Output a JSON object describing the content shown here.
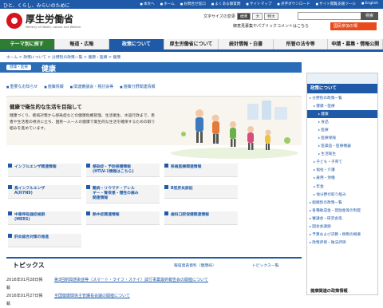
{
  "header": {
    "tagline": "ひと、くらし、みらいのために",
    "toplinks": [
      "本文へ",
      "ホーム",
      "お問合せ窓口",
      "よくある御質問",
      "サイトマップ",
      "点字ダウンロード",
      "サイト閲覧支援ツール",
      "English"
    ],
    "logo_text": "厚生労働省",
    "logo_en": "Ministry of Health, Labour and Welfare",
    "size_label": "文字サイズの変更",
    "size_opts": [
      "標準",
      "大",
      "特大"
    ],
    "search_placeholder": "",
    "search_button": "検索",
    "pr_link": "御意見募集やパブリックコメントはこちら",
    "join_button": "国民参加の場"
  },
  "nav": [
    "テーマ別に探す",
    "報道・広報",
    "政策について",
    "厚生労働省について",
    "統計情報・白書",
    "所管の法令等",
    "申請・募集・情報公開"
  ],
  "breadcrumb": "ホーム > 政策について > 分野別の政策一覧 > 健康・医療 > 健康",
  "page": {
    "category": "健康・医療",
    "title": "健康",
    "tabs": [
      "重要なお知らせ",
      "施策情報",
      "関連審議会・検討会等",
      "施策分野関連情報"
    ]
  },
  "lede": {
    "heading": "健康で衛生的な生活を目指して",
    "body": "健康づくり、疾病対策から感染症などの健康危機管理、生活衛生、水道行政まで、患者や生活者の視点に立ち、国民一人一人の健康で衛生的な生活を確保するための取り組みを進めています。"
  },
  "tiles": [
    [
      "インフルエンザ関連情報"
    ],
    [
      "感染症・予防接種情報",
      "(HTLV-1情報はこちら)"
    ],
    [
      "移植医療関連情報"
    ],
    [
      "鳥インフルエンザ",
      "A(H7N9)"
    ],
    [
      "難病・リウマチ・アレル",
      "ギー・腎疾患・慢性の痛み",
      "関連情報"
    ],
    [
      "B型肝炎訴訟"
    ],
    [
      "中東呼吸器症候群",
      "(MERS)"
    ],
    [
      "熱中症関連情報"
    ],
    [
      "歯科口腔保健関連情報"
    ],
    [
      "肝炎総合対策の推進"
    ]
  ],
  "topics": {
    "title": "トピックス",
    "links": [
      "報道発表資料（健康局）",
      "トピックス一覧"
    ],
    "items": [
      {
        "date": "2016年01月28日掲載",
        "text": "第3回新興感染症等（スマート・ライフ・ステイ）試行事業最終報告会の開催について"
      },
      {
        "date": "2016年01月27日掲載",
        "text": "全国健康関係主管課長会議の開催について"
      }
    ]
  },
  "sidebar": {
    "heading": "政策について",
    "items": [
      {
        "label": "分野別の政策一覧",
        "lvl": 1
      },
      {
        "label": "健康・医療",
        "lvl": 2
      },
      {
        "label": "健康",
        "lvl": 3,
        "sel": true
      },
      {
        "label": "食品",
        "lvl": 3
      },
      {
        "label": "医療",
        "lvl": 3
      },
      {
        "label": "医療保険",
        "lvl": 3
      },
      {
        "label": "医薬品・医療機器",
        "lvl": 3
      },
      {
        "label": "生活衛生",
        "lvl": 3
      },
      {
        "label": "子ども・子育て",
        "lvl": 2
      },
      {
        "label": "福祉・介護",
        "lvl": 2
      },
      {
        "label": "雇用・労働",
        "lvl": 2
      },
      {
        "label": "年金",
        "lvl": 2
      },
      {
        "label": "他分野の取り組み",
        "lvl": 2
      },
      {
        "label": "組織別の政策一覧",
        "lvl": 1
      },
      {
        "label": "各種助成金・奨励金等の制度",
        "lvl": 1
      },
      {
        "label": "審議会・研究会等",
        "lvl": 1
      },
      {
        "label": "国会会議録",
        "lvl": 1
      },
      {
        "label": "予算および決算・税制の概要",
        "lvl": 1
      },
      {
        "label": "政策評価・独法評価",
        "lvl": 1
      }
    ],
    "bottom": "健康関連の政策情報"
  }
}
